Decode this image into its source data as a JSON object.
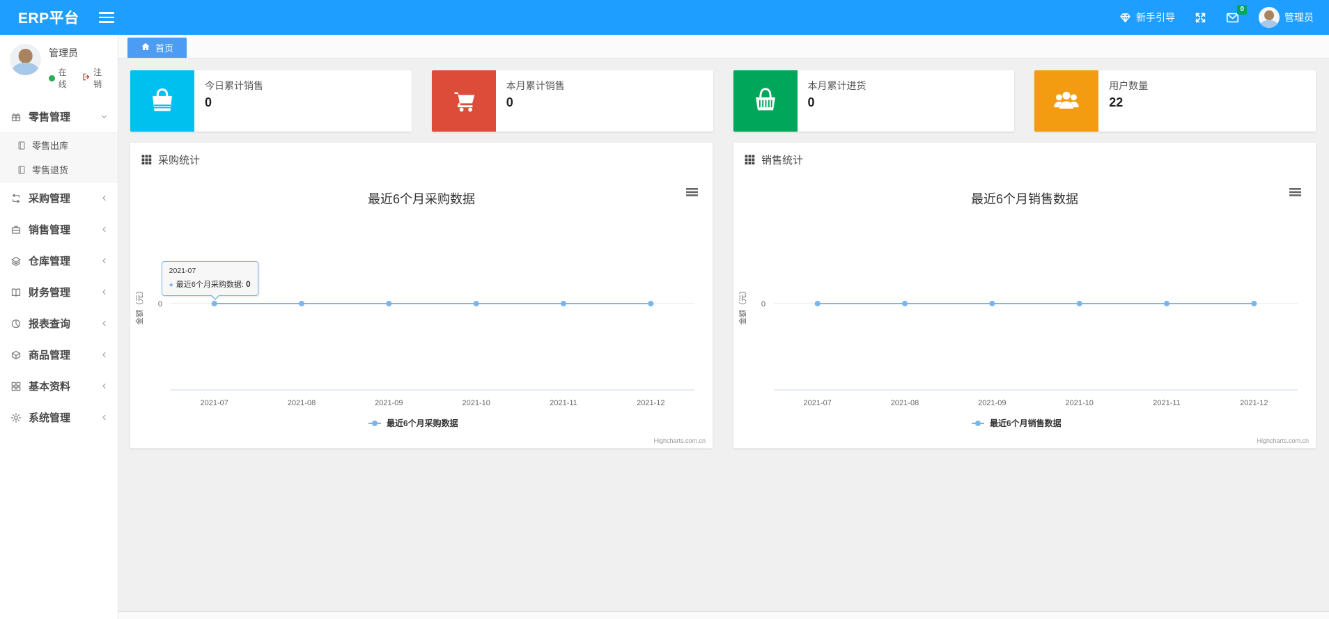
{
  "header": {
    "app_title": "ERP平台",
    "guide_label": "新手引导",
    "mail_badge": "0",
    "username": "管理员"
  },
  "sidebar": {
    "user": {
      "name": "管理员",
      "status": "在线",
      "logout": "注销"
    },
    "menu": [
      {
        "icon": "gift-icon",
        "label": "零售管理",
        "state": "expanded",
        "children": [
          {
            "icon": "file-icon",
            "label": "零售出库"
          },
          {
            "icon": "file-icon",
            "label": "零售退货"
          }
        ]
      },
      {
        "icon": "repeat-icon",
        "label": "采购管理",
        "state": "collapsed",
        "children": []
      },
      {
        "icon": "briefcase-icon",
        "label": "销售管理",
        "state": "collapsed",
        "children": []
      },
      {
        "icon": "layers-icon",
        "label": "仓库管理",
        "state": "collapsed",
        "children": []
      },
      {
        "icon": "book-icon",
        "label": "财务管理",
        "state": "collapsed",
        "children": []
      },
      {
        "icon": "pie-icon",
        "label": "报表查询",
        "state": "collapsed",
        "children": []
      },
      {
        "icon": "package-icon",
        "label": "商品管理",
        "state": "collapsed",
        "children": []
      },
      {
        "icon": "grid-icon",
        "label": "基本资料",
        "state": "collapsed",
        "children": []
      },
      {
        "icon": "gear-icon",
        "label": "系统管理",
        "state": "collapsed",
        "children": []
      }
    ]
  },
  "tabs": {
    "home_label": "首页"
  },
  "stat_cards": [
    {
      "icon": "shopping-bag-icon",
      "color": "#00c0ef",
      "label": "今日累计销售",
      "value": "0"
    },
    {
      "icon": "shopping-cart-icon",
      "color": "#dd4b39",
      "label": "本月累计销售",
      "value": "0"
    },
    {
      "icon": "shopping-basket-icon",
      "color": "#00a65a",
      "label": "本月累计进货",
      "value": "0"
    },
    {
      "icon": "users-icon",
      "color": "#f39c12",
      "label": "用户数量",
      "value": "22"
    }
  ],
  "chart_data": [
    {
      "type": "line",
      "panel_title": "采购统计",
      "title": "最近6个月采购数据",
      "categories": [
        "2021-07",
        "2021-08",
        "2021-09",
        "2021-10",
        "2021-11",
        "2021-12"
      ],
      "series": [
        {
          "name": "最近6个月采购数据",
          "values": [
            0,
            0,
            0,
            0,
            0,
            0
          ]
        }
      ],
      "ylabel": "金额（元）",
      "yticks": [
        "0"
      ],
      "ylim": [
        -1,
        1
      ],
      "grid": "zero-line-only",
      "legend_position": "bottom",
      "line_color": "#7cb5ec",
      "credits": "Highcharts.com.cn",
      "tooltip": {
        "visible": true,
        "header": "2021-07",
        "series_label": "最近6个月采购数据",
        "value": "0"
      }
    },
    {
      "type": "line",
      "panel_title": "销售统计",
      "title": "最近6个月销售数据",
      "categories": [
        "2021-07",
        "2021-08",
        "2021-09",
        "2021-10",
        "2021-11",
        "2021-12"
      ],
      "series": [
        {
          "name": "最近6个月销售数据",
          "values": [
            0,
            0,
            0,
            0,
            0,
            0
          ]
        }
      ],
      "ylabel": "金额（元）",
      "yticks": [
        "0"
      ],
      "ylim": [
        -1,
        1
      ],
      "grid": "zero-line-only",
      "legend_position": "bottom",
      "line_color": "#7cb5ec",
      "credits": "Highcharts.com.cn",
      "tooltip": {
        "visible": false
      }
    }
  ],
  "colors": {
    "header_blue": "#1E9FFF",
    "tab_blue": "#4C9CF3",
    "badge_green": "#00a65a",
    "online_green": "#2dab55",
    "logout_red": "#c9302c",
    "series_blue": "#7cb5ec"
  }
}
